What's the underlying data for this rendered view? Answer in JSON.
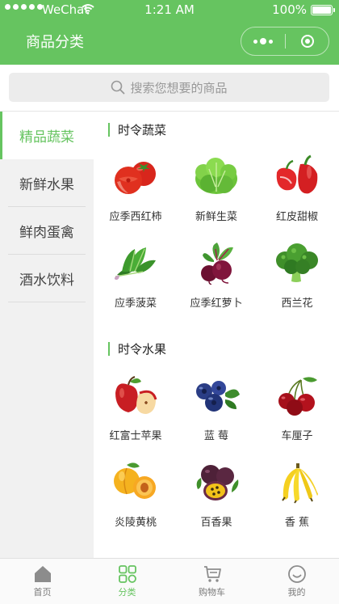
{
  "status": {
    "carrier": "WeChat",
    "time": "1:21 AM",
    "battery": "100%"
  },
  "nav": {
    "title": "商品分类"
  },
  "search": {
    "placeholder": "搜索您想要的商品"
  },
  "sidebar": {
    "items": [
      {
        "label": "精品蔬菜",
        "active": true
      },
      {
        "label": "新鲜水果",
        "active": false
      },
      {
        "label": "鲜肉蛋禽",
        "active": false
      },
      {
        "label": "酒水饮料",
        "active": false
      }
    ]
  },
  "sections": [
    {
      "title": "时令蔬菜",
      "items": [
        {
          "label": "应季西红柿",
          "icon": "tomato-icon"
        },
        {
          "label": "新鲜生菜",
          "icon": "lettuce-icon"
        },
        {
          "label": "红皮甜椒",
          "icon": "bell-pepper-icon"
        },
        {
          "label": "应季菠菜",
          "icon": "spinach-icon"
        },
        {
          "label": "应季红萝卜",
          "icon": "beet-icon"
        },
        {
          "label": "西兰花",
          "icon": "broccoli-icon"
        }
      ]
    },
    {
      "title": "时令水果",
      "items": [
        {
          "label": "红富士苹果",
          "icon": "apple-icon"
        },
        {
          "label": "蓝 莓",
          "icon": "blueberry-icon"
        },
        {
          "label": "车厘子",
          "icon": "cherry-icon"
        },
        {
          "label": "炎陵黄桃",
          "icon": "peach-icon"
        },
        {
          "label": "百香果",
          "icon": "passion-fruit-icon"
        },
        {
          "label": "香 蕉",
          "icon": "banana-icon"
        }
      ]
    }
  ],
  "tabbar": {
    "items": [
      {
        "label": "首页",
        "icon": "home-icon",
        "active": false
      },
      {
        "label": "分类",
        "icon": "category-icon",
        "active": true
      },
      {
        "label": "购物车",
        "icon": "cart-icon",
        "active": false
      },
      {
        "label": "我的",
        "icon": "profile-icon",
        "active": false
      }
    ]
  },
  "colors": {
    "accent": "#66c460",
    "sidebar_bg": "#f1f1f1",
    "search_bg": "#ececec"
  }
}
